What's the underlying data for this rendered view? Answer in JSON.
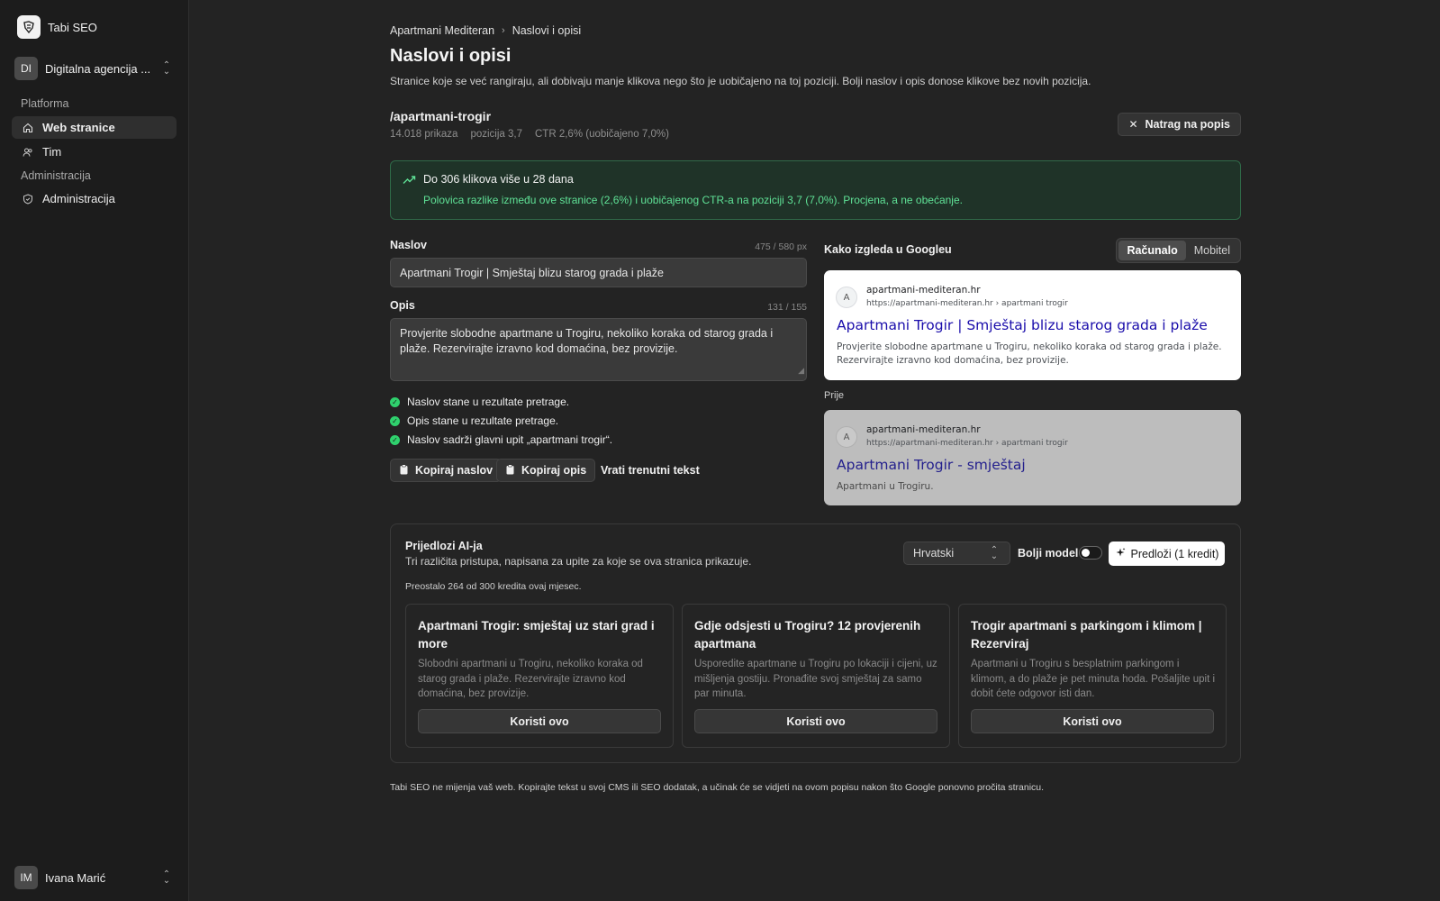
{
  "sidebar": {
    "brand": "Tabi SEO",
    "org": {
      "initials": "DI",
      "name": "Digitalna agencija ..."
    },
    "groups": [
      {
        "label": "Platforma"
      },
      {
        "label": "Administracija"
      }
    ],
    "items": [
      {
        "label": "Web stranice",
        "icon": "home-icon",
        "active": true
      },
      {
        "label": "Tim",
        "icon": "users-icon",
        "active": false
      },
      {
        "label": "Administracija",
        "icon": "shield-icon",
        "active": false
      }
    ],
    "user": {
      "initials": "IM",
      "name": "Ivana Marić"
    }
  },
  "header": {
    "breadcrumb": [
      "Apartmani Mediteran",
      "Naslovi i opisi"
    ],
    "title": "Naslovi i opisi",
    "description": "Stranice koje se već rangiraju, ali dobivaju manje klikova nego što je uobičajeno na toj poziciji. Bolji naslov i opis donose klikove bez novih pozicija."
  },
  "page": {
    "url": "/apartmani-trogir",
    "impressions": "14.018 prikaza",
    "position": "pozicija 3,7",
    "ctr": "CTR 2,6% (uobičajeno 7,0%)",
    "back_label": "Natrag na popis"
  },
  "alert": {
    "title": "Do 306 klikova više u 28 dana",
    "body": "Polovica razlike između ove stranice (2,6%) i uobičajenog CTR-a na poziciji 3,7 (7,0%). Procjena, a ne obećanje."
  },
  "editor": {
    "title_label": "Naslov",
    "title_count": "475 / 580 px",
    "title_value": "Apartmani Trogir | Smještaj blizu starog grada i plaže",
    "desc_label": "Opis",
    "desc_count": "131 / 155",
    "desc_value": "Provjerite slobodne apartmane u Trogiru, nekoliko koraka od starog grada i plaže. Rezervirajte izravno kod domaćina, bez provizije.",
    "checks": [
      "Naslov stane u rezultate pretrage.",
      "Opis stane u rezultate pretrage.",
      "Naslov sadrži glavni upit „apartmani trogir“."
    ],
    "copy_title": "Kopiraj naslov",
    "copy_desc": "Kopiraj opis",
    "restore": "Vrati trenutni tekst"
  },
  "preview": {
    "label": "Kako izgleda u Googleu",
    "modes": [
      "Računalo",
      "Mobitel"
    ],
    "active_mode": "Računalo",
    "after": {
      "favicon": "A",
      "site": "apartmani-mediteran.hr",
      "path": "https://apartmani-mediteran.hr › apartmani trogir",
      "title": "Apartmani Trogir | Smještaj blizu starog grada i plaže",
      "desc": "Provjerite slobodne apartmane u Trogiru, nekoliko koraka od starog grada i plaže. Rezervirajte izravno kod domaćina, bez provizije."
    },
    "before_label": "Prije",
    "before": {
      "favicon": "A",
      "site": "apartmani-mediteran.hr",
      "path": "https://apartmani-mediteran.hr › apartmani trogir",
      "title": "Apartmani Trogir - smještaj",
      "desc": "Apartmani u Trogiru."
    }
  },
  "ai": {
    "title": "Prijedlozi AI-ja",
    "subtitle": "Tri različita pristupa, napisana za upite za koje se ova stranica prikazuje.",
    "credits": "Preostalo 264 od 300 kredita ovaj mjesec.",
    "language": "Hrvatski",
    "better_model": "Bolji model",
    "better_model_on": false,
    "suggest_label": "Predloži (1 kredit)",
    "use_label": "Koristi ovo",
    "suggestions": [
      {
        "title": "Apartmani Trogir: smještaj uz stari grad i more",
        "desc": "Slobodni apartmani u Trogiru, nekoliko koraka od starog grada i plaže. Rezervirajte izravno kod domaćina, bez provizije."
      },
      {
        "title": "Gdje odsjesti u Trogiru? 12 provjerenih apartmana",
        "desc": "Usporedite apartmane u Trogiru po lokaciji i cijeni, uz mišljenja gostiju. Pronađite svoj smještaj za samo par minuta."
      },
      {
        "title": "Trogir apartmani s parkingom i klimom | Rezerviraj",
        "desc": "Apartmani u Trogiru s besplatnim parkingom i klimom, a do plaže je pet minuta hoda. Pošaljite upit i dobit ćete odgovor isti dan."
      }
    ]
  },
  "footer": "Tabi SEO ne mijenja vaš web. Kopirajte tekst u svoj CMS ili SEO dodatak, a učinak će se vidjeti na ovom popisu nakon što Google ponovno pročita stranicu.",
  "colors": {
    "success": "#2fd16d",
    "alert_text": "#5fe196",
    "link": "#1a0dab"
  }
}
